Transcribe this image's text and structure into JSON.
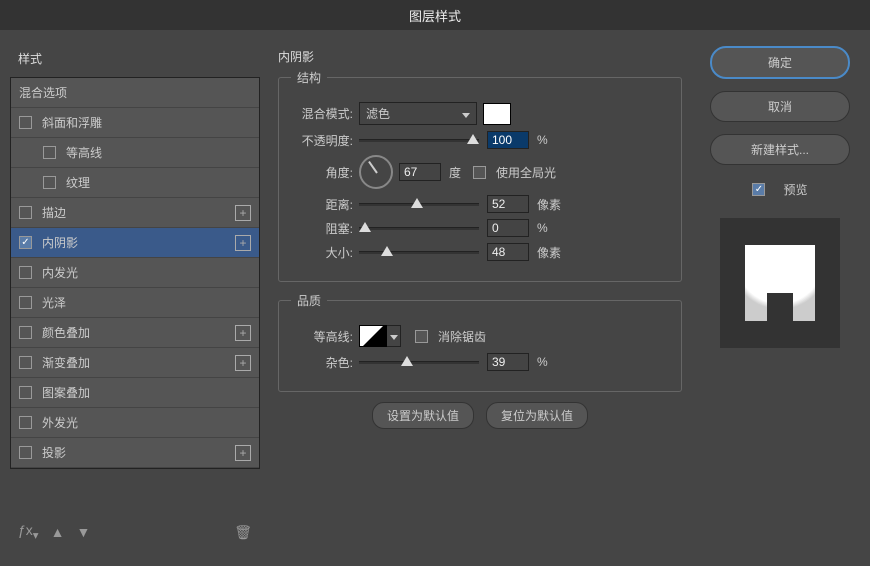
{
  "title": "图层样式",
  "sidebar": {
    "header": "样式",
    "items": [
      {
        "label": "混合选项",
        "hasCheck": false
      },
      {
        "label": "斜面和浮雕",
        "hasCheck": true,
        "checked": false
      },
      {
        "label": "等高线",
        "hasCheck": true,
        "checked": false,
        "sub": true
      },
      {
        "label": "纹理",
        "hasCheck": true,
        "checked": false,
        "sub": true
      },
      {
        "label": "描边",
        "hasCheck": true,
        "checked": false,
        "add": true
      },
      {
        "label": "内阴影",
        "hasCheck": true,
        "checked": true,
        "add": true,
        "active": true
      },
      {
        "label": "内发光",
        "hasCheck": true,
        "checked": false
      },
      {
        "label": "光泽",
        "hasCheck": true,
        "checked": false
      },
      {
        "label": "颜色叠加",
        "hasCheck": true,
        "checked": false,
        "add": true
      },
      {
        "label": "渐变叠加",
        "hasCheck": true,
        "checked": false,
        "add": true
      },
      {
        "label": "图案叠加",
        "hasCheck": true,
        "checked": false
      },
      {
        "label": "外发光",
        "hasCheck": true,
        "checked": false
      },
      {
        "label": "投影",
        "hasCheck": true,
        "checked": false,
        "add": true
      }
    ]
  },
  "content": {
    "title": "内阴影",
    "structure": {
      "legend": "结构",
      "blend_label": "混合模式:",
      "blend_value": "滤色",
      "opacity_label": "不透明度:",
      "opacity_value": "100",
      "pct": "%",
      "angle_label": "角度:",
      "angle_value": "67",
      "deg": "度",
      "global_label": "使用全局光",
      "distance_label": "距离:",
      "distance_value": "52",
      "px": "像素",
      "choke_label": "阻塞:",
      "choke_value": "0",
      "size_label": "大小:",
      "size_value": "48"
    },
    "quality": {
      "legend": "品质",
      "contour_label": "等高线:",
      "antialias_label": "消除锯齿",
      "noise_label": "杂色:",
      "noise_value": "39"
    },
    "default_btn": "设置为默认值",
    "reset_btn": "复位为默认值"
  },
  "right": {
    "ok": "确定",
    "cancel": "取消",
    "newstyle": "新建样式...",
    "preview": "预览"
  }
}
